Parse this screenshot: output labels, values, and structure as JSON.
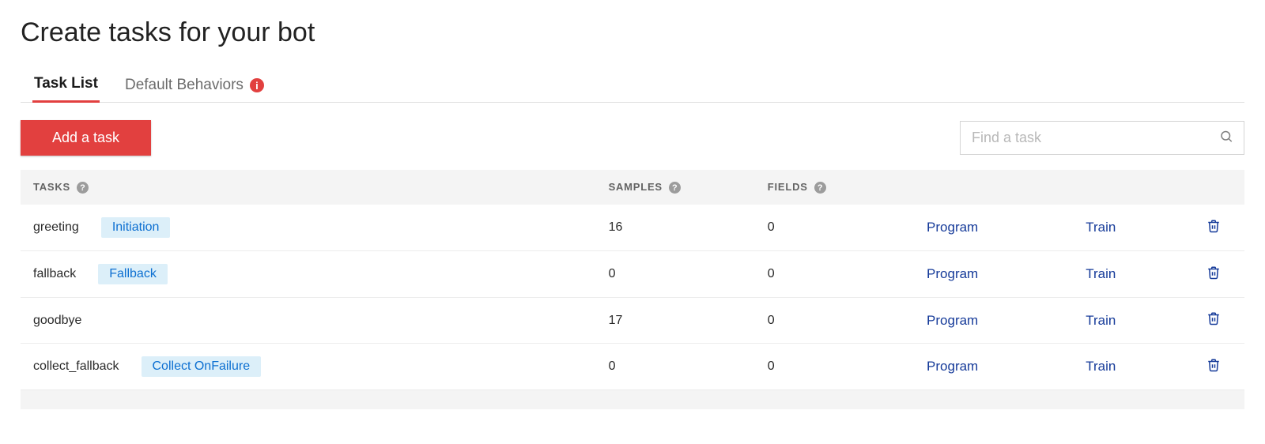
{
  "page": {
    "title": "Create tasks for your bot"
  },
  "tabs": {
    "task_list": "Task List",
    "default_behaviors": "Default Behaviors"
  },
  "toolbar": {
    "add_task_label": "Add a task",
    "search_placeholder": "Find a task"
  },
  "columns": {
    "tasks": "Tasks",
    "samples": "Samples",
    "fields": "Fields"
  },
  "actions": {
    "program": "Program",
    "train": "Train"
  },
  "tasks": [
    {
      "name": "greeting",
      "tag": "Initiation",
      "samples": "16",
      "fields": "0"
    },
    {
      "name": "fallback",
      "tag": "Fallback",
      "samples": "0",
      "fields": "0"
    },
    {
      "name": "goodbye",
      "tag": "",
      "samples": "17",
      "fields": "0"
    },
    {
      "name": "collect_fallback",
      "tag": "Collect OnFailure",
      "samples": "0",
      "fields": "0"
    }
  ]
}
